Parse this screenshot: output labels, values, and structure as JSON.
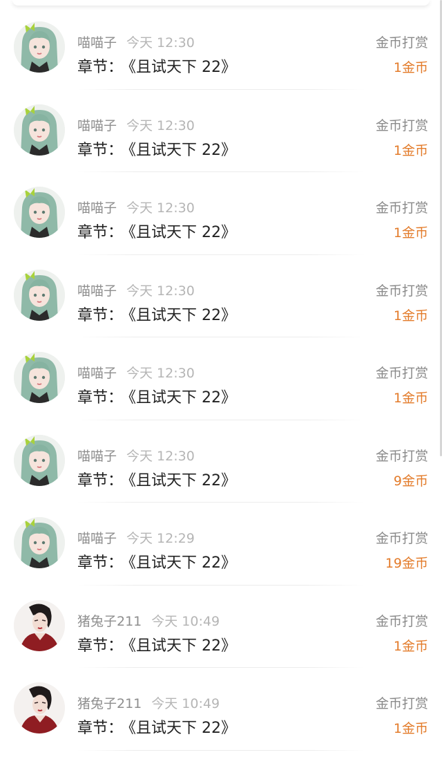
{
  "rows": [
    {
      "avatar": "green-hair-girl-avatar",
      "username": "喵喵子",
      "time": "今天 12:30",
      "chapter_label": "章节：",
      "chapter_title": "《且试天下 22》",
      "tip_type": "金币打赏",
      "amount": "1金币"
    },
    {
      "avatar": "green-hair-girl-avatar",
      "username": "喵喵子",
      "time": "今天 12:30",
      "chapter_label": "章节：",
      "chapter_title": "《且试天下 22》",
      "tip_type": "金币打赏",
      "amount": "1金币"
    },
    {
      "avatar": "green-hair-girl-avatar",
      "username": "喵喵子",
      "time": "今天 12:30",
      "chapter_label": "章节：",
      "chapter_title": "《且试天下 22》",
      "tip_type": "金币打赏",
      "amount": "1金币"
    },
    {
      "avatar": "green-hair-girl-avatar",
      "username": "喵喵子",
      "time": "今天 12:30",
      "chapter_label": "章节：",
      "chapter_title": "《且试天下 22》",
      "tip_type": "金币打赏",
      "amount": "1金币"
    },
    {
      "avatar": "green-hair-girl-avatar",
      "username": "喵喵子",
      "time": "今天 12:30",
      "chapter_label": "章节：",
      "chapter_title": "《且试天下 22》",
      "tip_type": "金币打赏",
      "amount": "1金币"
    },
    {
      "avatar": "green-hair-girl-avatar",
      "username": "喵喵子",
      "time": "今天 12:30",
      "chapter_label": "章节：",
      "chapter_title": "《且试天下 22》",
      "tip_type": "金币打赏",
      "amount": "9金币"
    },
    {
      "avatar": "green-hair-girl-avatar",
      "username": "喵喵子",
      "time": "今天 12:29",
      "chapter_label": "章节：",
      "chapter_title": "《且试天下 22》",
      "tip_type": "金币打赏",
      "amount": "19金币"
    },
    {
      "avatar": "red-dress-woman-avatar",
      "username": "猪兔子211",
      "time": "今天 10:49",
      "chapter_label": "章节：",
      "chapter_title": "《且试天下 22》",
      "tip_type": "金币打赏",
      "amount": "1金币"
    },
    {
      "avatar": "red-dress-woman-avatar",
      "username": "猪兔子211",
      "time": "今天 10:49",
      "chapter_label": "章节：",
      "chapter_title": "《且试天下 22》",
      "tip_type": "金币打赏",
      "amount": "1金币"
    }
  ],
  "colors": {
    "amount": "#e37b2a",
    "username": "#8e8e8e",
    "time": "#b5b5b5",
    "chapter": "#222222"
  }
}
